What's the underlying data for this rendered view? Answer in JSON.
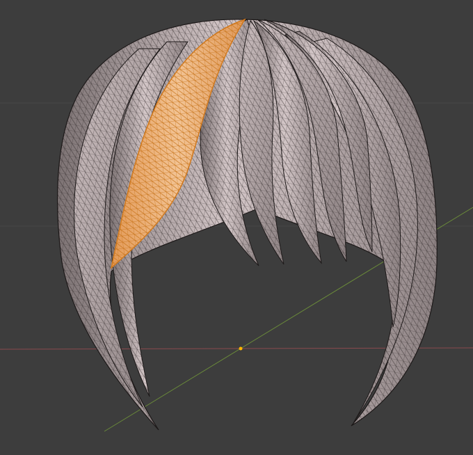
{
  "viewport": {
    "background": "#3d3d3d",
    "grid_line_color": "#474747",
    "x_axis_color": "#8a4a4e",
    "y_axis_color": "#6a8a3a",
    "origin_color": "#ffb400"
  },
  "mesh": {
    "strand_fill": "#b5a9ab",
    "strand_fill_light": "#d3c6c7",
    "strand_fill_dark": "#7d7374",
    "wire_color": "#2a2424",
    "selected_fill": "#e9a66a",
    "selected_wire": "#d27a1e",
    "selected_light": "#f2c394"
  }
}
